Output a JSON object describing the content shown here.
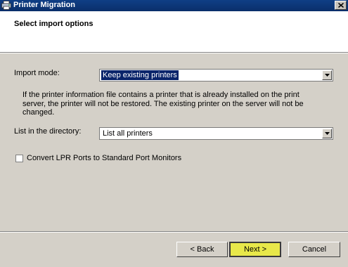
{
  "window": {
    "title": "Printer Migration"
  },
  "header": {
    "title": "Select import options"
  },
  "import_mode": {
    "label": "Import mode:",
    "selected": "Keep existing printers",
    "description": "If the printer information file contains a printer that is already installed on the print server, the printer will not be restored. The existing printer on the server will not be changed."
  },
  "directory": {
    "label": "List in the directory:",
    "selected": "List all printers"
  },
  "options": {
    "convert_lpr_label": "Convert LPR Ports to Standard Port Monitors",
    "convert_lpr_checked": false
  },
  "buttons": {
    "back": "< Back",
    "next": "Next >",
    "cancel": "Cancel"
  },
  "colors": {
    "title_bar": "#0f3f86",
    "selection": "#0a246a",
    "next_highlight": "#e8e84a"
  }
}
